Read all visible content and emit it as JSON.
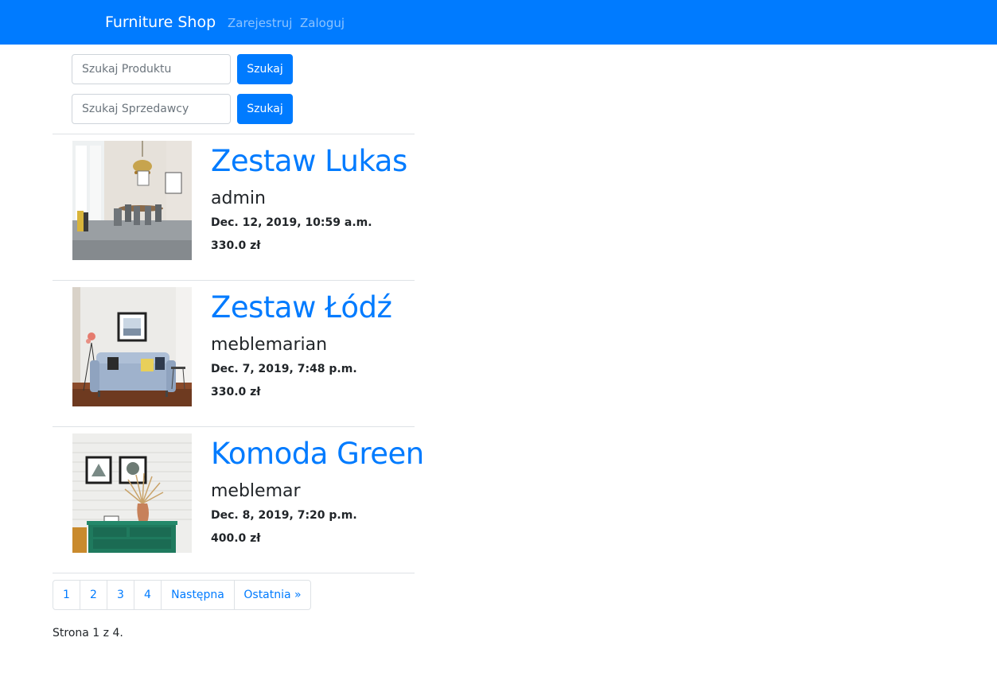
{
  "navbar": {
    "brand": "Furniture Shop",
    "links": [
      "Zarejestruj",
      "Zaloguj"
    ]
  },
  "search": {
    "product_placeholder": "Szukaj Produktu",
    "seller_placeholder": "Szukaj Sprzedawcy",
    "button_label": "Szukaj"
  },
  "products": [
    {
      "title": "Zestaw Lukas",
      "seller": "admin",
      "date": "Dec. 12, 2019, 10:59 a.m.",
      "price": "330.0 zł",
      "image": "dining-room-photo"
    },
    {
      "title": "Zestaw Łódź",
      "seller": "meblemarian",
      "date": "Dec. 7, 2019, 7:48 p.m.",
      "price": "330.0 zł",
      "image": "sofa-living-room-photo"
    },
    {
      "title": "Komoda Green",
      "seller": "meblemar",
      "date": "Dec. 8, 2019, 7:20 p.m.",
      "price": "400.0 zł",
      "image": "green-dresser-photo"
    }
  ],
  "pagination": {
    "pages": [
      "1",
      "2",
      "3",
      "4"
    ],
    "next_label": "Następna",
    "last_label": "Ostatnia »",
    "status": "Strona 1 z 4."
  },
  "colors": {
    "primary": "#007bff",
    "text": "#212529",
    "border": "#dee2e6"
  }
}
